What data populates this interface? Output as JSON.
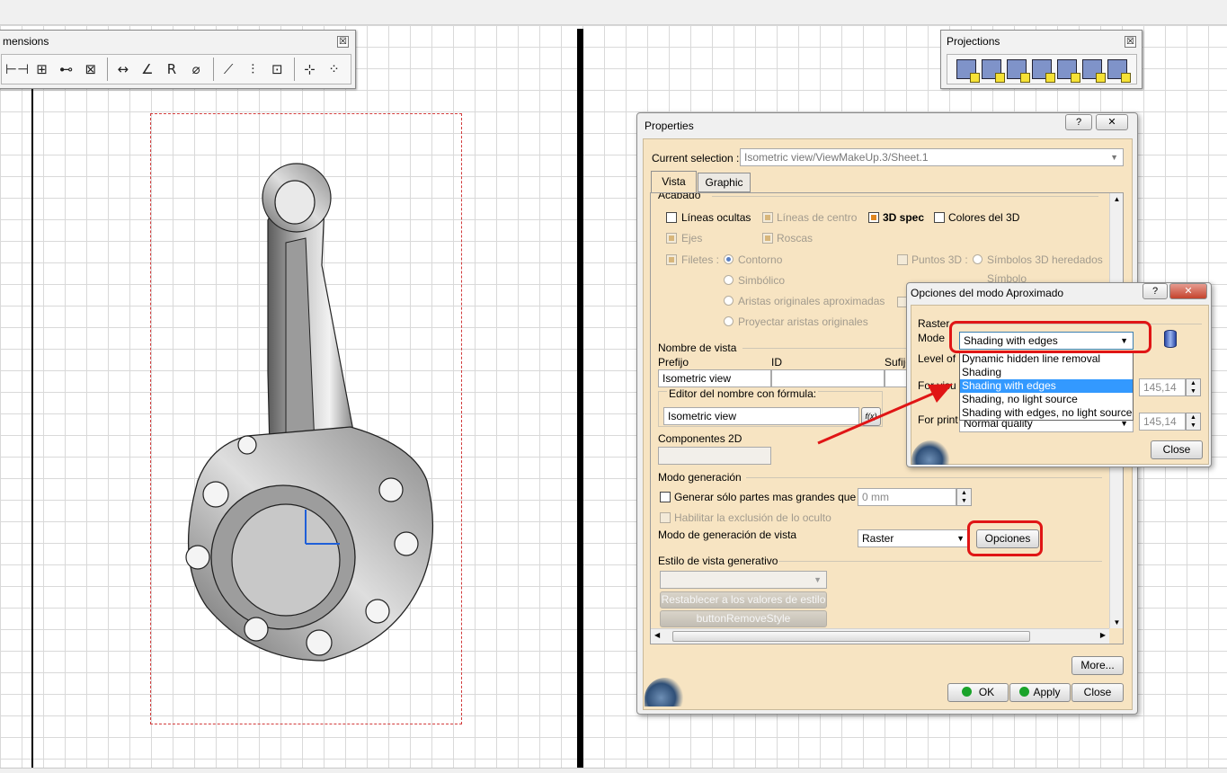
{
  "dimensions_toolbar": {
    "title": "mensions",
    "close": "☒"
  },
  "projections_toolbar": {
    "title": "Projections",
    "close": "☒"
  },
  "properties": {
    "title": "Properties",
    "help": "?",
    "close": "✕",
    "current_selection_label": "Current selection :",
    "current_selection_value": "Isometric view/ViewMakeUp.3/Sheet.1",
    "tabs": [
      "Vista",
      "Graphic"
    ],
    "acabado": "Acabado",
    "lineas_ocultas": "Líneas ocultas",
    "lineas_centro": "Líneas de centro",
    "spec_3d": "3D spec",
    "colores_3d": "Colores del 3D",
    "ejes": "Ejes",
    "roscas": "Roscas",
    "filetes": "Filetes :",
    "contorno": "Contorno",
    "puntos_3d": "Puntos 3D :",
    "simbolos_3d": "Símbolos 3D heredados",
    "simbolo": "Símbolo",
    "simbolico": "Simbólico",
    "aristas_aprox": "Aristas originales aproximadas",
    "proyectar_aristas": "Proyectar aristas originales",
    "nombre_vista": "Nombre de vista",
    "prefijo": "Prefijo",
    "id": "ID",
    "sufijo": "Sufijo",
    "prefijo_value": "Isometric view",
    "editor_formula": "Editor del nombre con fórmula:",
    "formula_value": "Isometric view",
    "fx": "f(x)",
    "componentes_2d": "Componentes 2D",
    "modo_generacion": "Modo generación",
    "generar_solo": "Generar sólo partes mas grandes que",
    "generar_value": "0 mm",
    "habilitar_exclusion": "Habilitar la exclusión de lo oculto",
    "modo_gen_vista": "Modo de generación de vista",
    "modo_gen_value": "Raster",
    "opciones": "Opciones",
    "estilo_vista": "Estilo de vista generativo",
    "restablecer": "Restablecer a los valores de estilo",
    "remove_style": "buttonRemoveStyle",
    "more": "More...",
    "ok": "OK",
    "apply": "Apply",
    "close_btn": "Close"
  },
  "approx_dialog": {
    "title": "Opciones del modo Aproximado",
    "help": "?",
    "close": "✕",
    "raster": "Raster",
    "mode": "Mode",
    "mode_value": "Shading with edges",
    "level_of": "Level of",
    "for_visu": "For visu",
    "for_print": "For print",
    "for_print_value": "Normal quality",
    "visu_dpi": "145,14",
    "print_dpi": "145,14",
    "close_btn": "Close",
    "options": [
      "Dynamic hidden line removal",
      "Shading",
      "Shading with edges",
      "Shading, no light source",
      "Shading with edges, no light source"
    ]
  },
  "colors": {
    "highlight": "#e01515",
    "panel": "#f7e4c2",
    "selection": "#3399ff"
  }
}
